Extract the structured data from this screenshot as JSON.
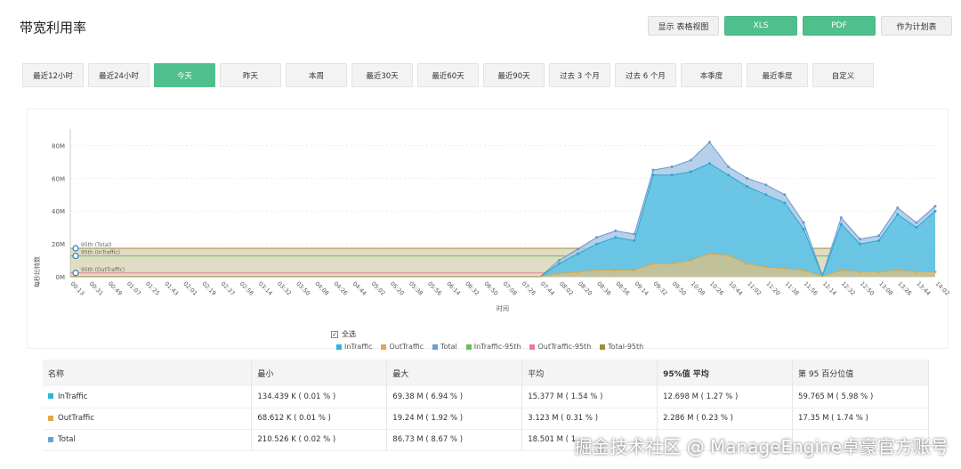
{
  "page_title": "带宽利用率",
  "toolbar": {
    "table_view": "显示 表格视图",
    "xls": "XLS",
    "pdf": "PDF",
    "schedule": "作为计划表"
  },
  "ranges": [
    "最近12小时",
    "最近24小时",
    "今天",
    "昨天",
    "本周",
    "最近30天",
    "最近60天",
    "最近90天",
    "过去 3 个月",
    "过去 6 个月",
    "本季度",
    "最近季度",
    "自定义"
  ],
  "active_range": "今天",
  "select_all": "全选",
  "colors": {
    "accent": "#4fc08d",
    "in_traffic": "#29b6d9",
    "out_traffic": "#e3a84b",
    "total": "#6aa0d6",
    "in_95": "#6bbf59",
    "out_95": "#e87aa0",
    "total_95": "#a88a3a"
  },
  "chart_data": {
    "type": "area",
    "ylabel": "每秒比特数",
    "xlabel": "时间",
    "y_ticks": [
      "0M",
      "20M",
      "40M",
      "60M",
      "80M"
    ],
    "ylim": [
      0,
      90
    ],
    "categories": [
      "00:13",
      "00:31",
      "00:49",
      "01:07",
      "01:25",
      "01:43",
      "02:01",
      "02:19",
      "02:37",
      "02:56",
      "03:14",
      "03:32",
      "03:50",
      "04:08",
      "04:26",
      "04:44",
      "05:02",
      "05:20",
      "05:38",
      "05:56",
      "06:14",
      "06:32",
      "06:50",
      "07:08",
      "07:26",
      "07:44",
      "08:02",
      "08:20",
      "08:38",
      "08:56",
      "09:14",
      "09:32",
      "09:50",
      "10:08",
      "10:26",
      "10:44",
      "11:02",
      "11:20",
      "11:38",
      "11:56",
      "12:14",
      "12:32",
      "12:50",
      "13:08",
      "13:26",
      "13:44",
      "14:02"
    ],
    "percentile_labels": [
      "95th (Total)",
      "95th (InTraffic)",
      "95th (OutTraffic)"
    ],
    "percentiles": {
      "total": 17.35,
      "in": 12.7,
      "out": 2.3
    },
    "series": [
      {
        "name": "InTraffic",
        "values": [
          0.1,
          0.1,
          0.1,
          0.1,
          0.1,
          0.1,
          0.1,
          0.1,
          0.1,
          0.1,
          0.1,
          0.1,
          0.1,
          0.1,
          0.1,
          0.1,
          0.1,
          0.1,
          0.1,
          0.1,
          0.1,
          0.1,
          0.1,
          0.1,
          0.1,
          0.1,
          8,
          14,
          20,
          24,
          22,
          62,
          62,
          64,
          69,
          62,
          55,
          50,
          45,
          29,
          0.5,
          32,
          20,
          22,
          38,
          30,
          40
        ]
      },
      {
        "name": "OutTraffic",
        "values": [
          0.05,
          0.05,
          0.05,
          0.05,
          0.05,
          0.05,
          0.05,
          0.05,
          0.05,
          0.05,
          0.05,
          0.05,
          0.05,
          0.05,
          0.05,
          0.05,
          0.05,
          0.05,
          0.05,
          0.05,
          0.05,
          0.05,
          0.05,
          0.05,
          0.05,
          0.05,
          2,
          3,
          4,
          4,
          4,
          8,
          8,
          10,
          14,
          13,
          8,
          6,
          5,
          4,
          0.2,
          4,
          3,
          3,
          4,
          3,
          3
        ]
      },
      {
        "name": "Total",
        "values": [
          0.15,
          0.15,
          0.15,
          0.15,
          0.15,
          0.15,
          0.15,
          0.15,
          0.15,
          0.15,
          0.15,
          0.15,
          0.15,
          0.15,
          0.15,
          0.15,
          0.15,
          0.15,
          0.15,
          0.15,
          0.15,
          0.15,
          0.15,
          0.15,
          0.15,
          0.15,
          10,
          17,
          24,
          28,
          26,
          65,
          67,
          71,
          82,
          67,
          60,
          56,
          50,
          33,
          0.7,
          36,
          23,
          25,
          42,
          33,
          43
        ]
      }
    ]
  },
  "legend": [
    "InTraffic",
    "OutTraffic",
    "Total",
    "InTraffic-95th",
    "OutTraffic-95th",
    "Total-95th"
  ],
  "table": {
    "headers": [
      "名称",
      "最小",
      "最大",
      "平均",
      "95%值 平均",
      "第 95 百分位值"
    ],
    "rows": [
      {
        "name": "InTraffic",
        "min": "134.439 K ( 0.01 % )",
        "max": "69.38 M ( 6.94 % )",
        "avg": "15.377 M ( 1.54 % )",
        "avg95": "12.698 M ( 1.27 % )",
        "p95": "59.765 M ( 5.98 % )"
      },
      {
        "name": "OutTraffic",
        "min": "68.612 K ( 0.01 % )",
        "max": "19.24 M ( 1.92 % )",
        "avg": "3.123 M ( 0.31 % )",
        "avg95": "2.286 M ( 0.23 % )",
        "p95": "17.35 M ( 1.74 % )"
      },
      {
        "name": "Total",
        "min": "210.526 K ( 0.02 % )",
        "max": "86.73 M ( 8.67 % )",
        "avg": "18.501 M ( 1.",
        "avg95": "",
        "p95": ""
      }
    ]
  },
  "watermark": "掘金技术社区 @ ManageEngine卓豪官方账号"
}
